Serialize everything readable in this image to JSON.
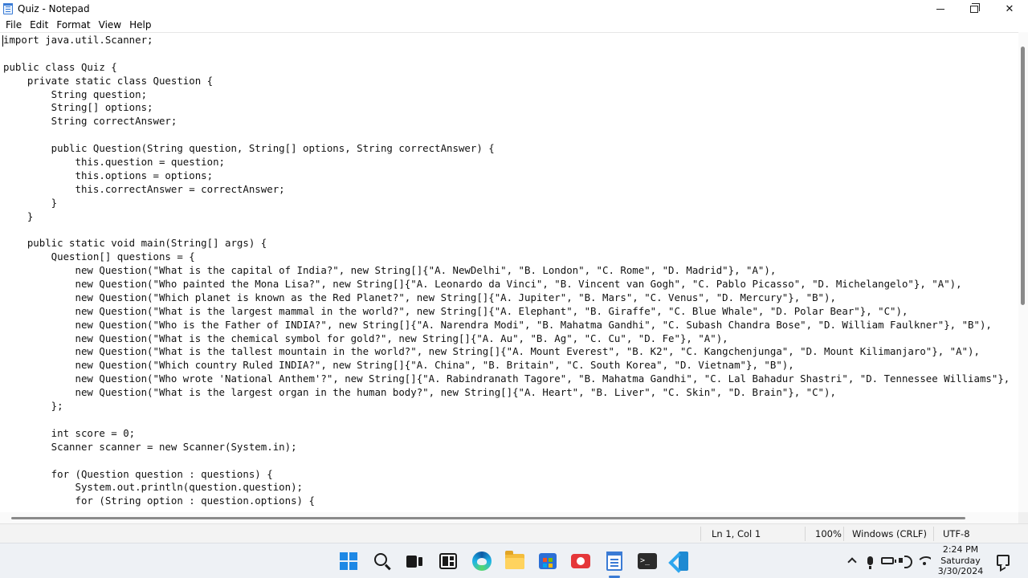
{
  "window": {
    "title": "Quiz - Notepad",
    "minimize": "",
    "maximize": "",
    "close": "✕"
  },
  "menu": {
    "items": [
      {
        "label": "File"
      },
      {
        "label": "Edit"
      },
      {
        "label": "Format"
      },
      {
        "label": "View"
      },
      {
        "label": "Help"
      }
    ]
  },
  "editor": {
    "lines": [
      "import java.util.Scanner;",
      "",
      "public class Quiz {",
      "    private static class Question {",
      "        String question;",
      "        String[] options;",
      "        String correctAnswer;",
      "",
      "        public Question(String question, String[] options, String correctAnswer) {",
      "            this.question = question;",
      "            this.options = options;",
      "            this.correctAnswer = correctAnswer;",
      "        }",
      "    }",
      "",
      "    public static void main(String[] args) {",
      "        Question[] questions = {",
      "            new Question(\"What is the capital of India?\", new String[]{\"A. NewDelhi\", \"B. London\", \"C. Rome\", \"D. Madrid\"}, \"A\"),",
      "            new Question(\"Who painted the Mona Lisa?\", new String[]{\"A. Leonardo da Vinci\", \"B. Vincent van Gogh\", \"C. Pablo Picasso\", \"D. Michelangelo\"}, \"A\"),",
      "            new Question(\"Which planet is known as the Red Planet?\", new String[]{\"A. Jupiter\", \"B. Mars\", \"C. Venus\", \"D. Mercury\"}, \"B\"),",
      "            new Question(\"What is the largest mammal in the world?\", new String[]{\"A. Elephant\", \"B. Giraffe\", \"C. Blue Whale\", \"D. Polar Bear\"}, \"C\"),",
      "            new Question(\"Who is the Father of INDIA?\", new String[]{\"A. Narendra Modi\", \"B. Mahatma Gandhi\", \"C. Subash Chandra Bose\", \"D. William Faulkner\"}, \"B\"),",
      "            new Question(\"What is the chemical symbol for gold?\", new String[]{\"A. Au\", \"B. Ag\", \"C. Cu\", \"D. Fe\"}, \"A\"),",
      "            new Question(\"What is the tallest mountain in the world?\", new String[]{\"A. Mount Everest\", \"B. K2\", \"C. Kangchenjunga\", \"D. Mount Kilimanjaro\"}, \"A\"),",
      "            new Question(\"Which country Ruled INDIA?\", new String[]{\"A. China\", \"B. Britain\", \"C. South Korea\", \"D. Vietnam\"}, \"B\"),",
      "            new Question(\"Who wrote 'National Anthem'?\", new String[]{\"A. Rabindranath Tagore\", \"B. Mahatma Gandhi\", \"C. Lal Bahadur Shastri\", \"D. Tennessee Williams\"},",
      "            new Question(\"What is the largest organ in the human body?\", new String[]{\"A. Heart\", \"B. Liver\", \"C. Skin\", \"D. Brain\"}, \"C\"),",
      "        };",
      "",
      "        int score = 0;",
      "        Scanner scanner = new Scanner(System.in);",
      "",
      "        for (Question question : questions) {",
      "            System.out.println(question.question);",
      "            for (String option : question.options) {"
    ]
  },
  "status": {
    "position": "Ln 1, Col 1",
    "zoom": "100%",
    "line_ending": "Windows (CRLF)",
    "encoding": "UTF-8"
  },
  "taskbar": {
    "clock_time": "2:24 PM",
    "clock_day": "Saturday",
    "clock_date": "3/30/2024"
  },
  "colors": {
    "accent": "#3a7bd5",
    "taskbar_bg": "#eef1f5",
    "statusbar_bg": "#f3f3f3"
  }
}
